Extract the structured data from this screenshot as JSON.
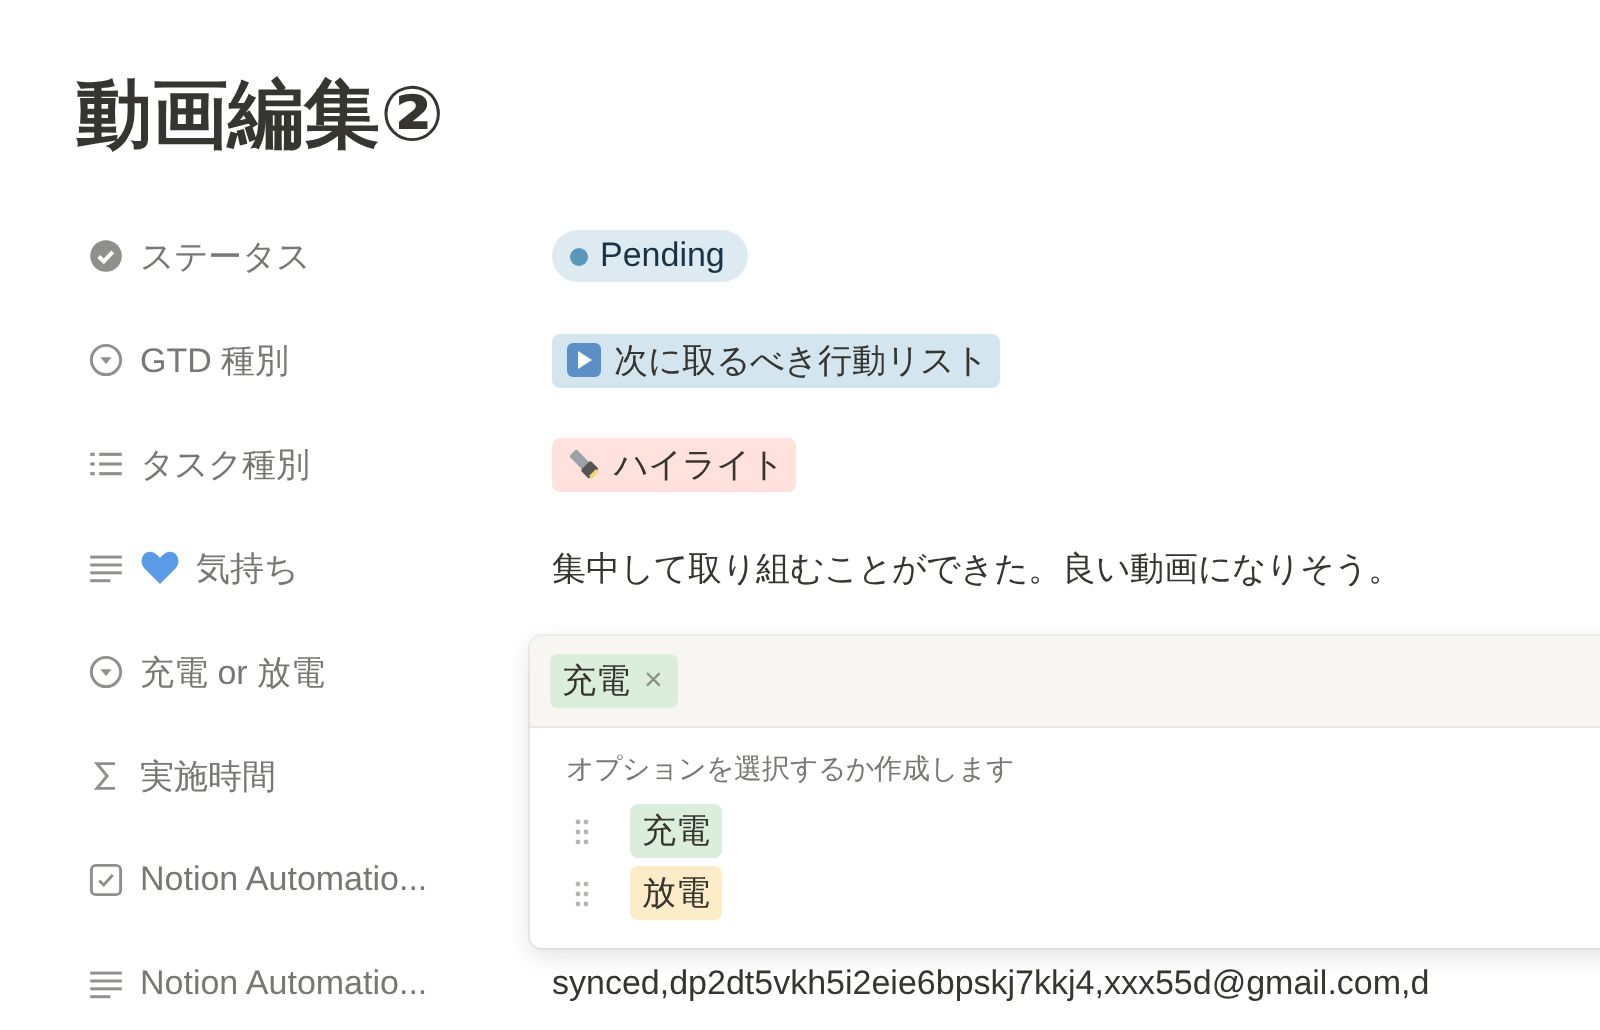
{
  "title": "動画編集②",
  "properties": [
    {
      "kind": "status",
      "label": "ステータス",
      "value": {
        "text": "Pending",
        "color": "#5b97bd"
      }
    },
    {
      "kind": "select",
      "label": "GTD 種別",
      "value": {
        "text": "次に取るべき行動リスト",
        "color": "#d3e5ef",
        "emoji": {
          "kind": "play"
        }
      }
    },
    {
      "kind": "multi_select",
      "label": "タスク種別",
      "value": {
        "text": "ハイライト",
        "color": "#ffe2dd",
        "emoji": {
          "kind": "flashlight"
        }
      }
    },
    {
      "kind": "text",
      "label": "気持ち",
      "emoji": {
        "kind": "heart"
      },
      "value": {
        "text": "集中して取り組むことができた。良い動画になりそう。"
      }
    },
    {
      "kind": "select",
      "label": "充電 or 放電"
    },
    {
      "kind": "formula",
      "label": "実施時間"
    },
    {
      "kind": "checkbox",
      "label": "Notion Automatio..."
    },
    {
      "kind": "text",
      "label": "Notion Automatio...",
      "value": {
        "text": "synced,dp2dt5vkh5i2eie6bpskj7kkj4,xxx55d@gmail.com,d"
      }
    }
  ],
  "dropdown": {
    "selected": [
      {
        "label": "充電",
        "color": "#dbeddb"
      }
    ],
    "remove": "×",
    "hint": "オプションを選択するか作成します",
    "options": [
      {
        "label": "充電",
        "color": "#dbeddb"
      },
      {
        "label": "放電",
        "color": "#fdecc8"
      }
    ]
  }
}
